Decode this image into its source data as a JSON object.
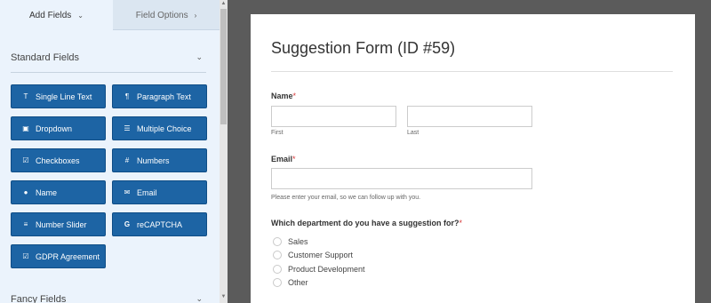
{
  "tabs": {
    "add_fields": "Add Fields",
    "field_options": "Field Options"
  },
  "standard_fields": {
    "title": "Standard Fields",
    "buttons": [
      {
        "label": "Single Line Text",
        "icon": "text-cursor-icon"
      },
      {
        "label": "Paragraph Text",
        "icon": "paragraph-icon"
      },
      {
        "label": "Dropdown",
        "icon": "dropdown-icon"
      },
      {
        "label": "Multiple Choice",
        "icon": "list-icon"
      },
      {
        "label": "Checkboxes",
        "icon": "checkbox-icon"
      },
      {
        "label": "Numbers",
        "icon": "hash-icon"
      },
      {
        "label": "Name",
        "icon": "user-icon"
      },
      {
        "label": "Email",
        "icon": "envelope-icon"
      },
      {
        "label": "Number Slider",
        "icon": "sliders-icon"
      },
      {
        "label": "reCAPTCHA",
        "icon": "google-icon"
      },
      {
        "label": "GDPR Agreement",
        "icon": "checkbox-icon"
      }
    ]
  },
  "fancy_fields": {
    "title": "Fancy Fields"
  },
  "form": {
    "title": "Suggestion Form (ID #59)",
    "name": {
      "label": "Name",
      "required_mark": "*",
      "first_sub": "First",
      "last_sub": "Last"
    },
    "email": {
      "label": "Email",
      "required_mark": "*",
      "description": "Please enter your email, so we can follow up with you."
    },
    "department": {
      "label": "Which department do you have a suggestion for?",
      "required_mark": "*",
      "options": [
        "Sales",
        "Customer Support",
        "Product Development",
        "Other"
      ]
    }
  },
  "colors": {
    "button_bg": "#1d64a4",
    "panel_bg": "#ebf3fc",
    "preview_bg": "#5b5b5b",
    "required": "#d63637"
  }
}
